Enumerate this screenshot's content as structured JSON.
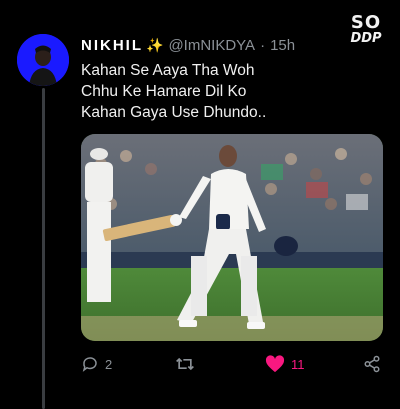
{
  "watermark": {
    "line1": "SO",
    "line2": "DDP"
  },
  "tweet": {
    "display_name": "NIKHIL",
    "handle": "@ImNIKDYA",
    "separator": "·",
    "timestamp": "15h",
    "text_lines": [
      "Kahan Se Aaya Tha Woh",
      "Chhu Ke Hamare Dil Ko",
      "Kahan Gaya Use Dhundo.."
    ]
  },
  "actions": {
    "reply_count": "2",
    "retweet_count": "",
    "like_count": "11",
    "like_color": "#f91880",
    "icon_color": "#8b9197",
    "icons": [
      "reply-icon",
      "retweet-icon",
      "like-heart-icon",
      "share-icon"
    ]
  }
}
